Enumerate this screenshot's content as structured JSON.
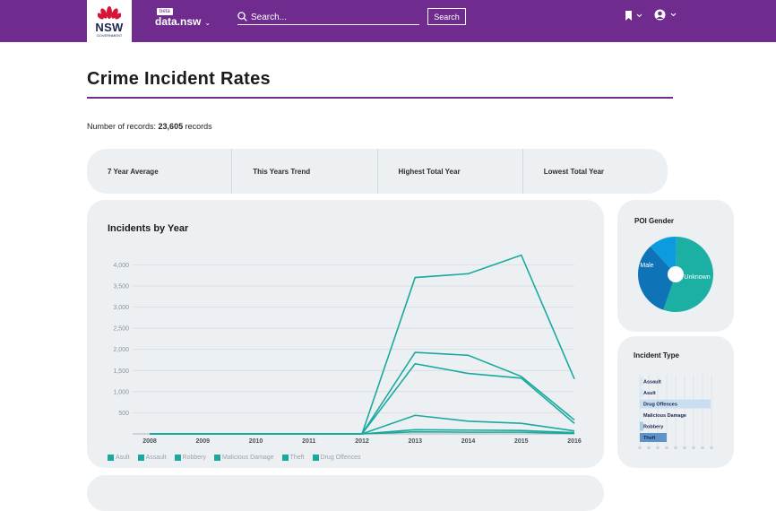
{
  "header": {
    "logo_text": "NSW",
    "logo_subtext": "GOVERNMENT",
    "beta_badge": "beta",
    "brand": "data.nsw",
    "search_placeholder": "Search...",
    "search_button": "Search",
    "bookmark_icon": "bookmark-icon",
    "account_icon": "user-icon"
  },
  "page": {
    "title": "Crime Incident Rates",
    "records_label": "Number of records:",
    "records_count": "23,605",
    "records_unit": "records"
  },
  "stats": [
    "7 Year Average",
    "This Years Trend",
    "Highest Total Year",
    "Lowest Total Year"
  ],
  "incidents_chart": {
    "title": "Incidents by Year",
    "chart_data": {
      "type": "line",
      "title": "Incidents by Year",
      "x": [
        "2008",
        "2009",
        "2010",
        "2011",
        "2012",
        "2013",
        "2014",
        "2015",
        "2016"
      ],
      "ylim": [
        0,
        4200
      ],
      "yticks": [
        "500",
        "1,000",
        "1,500",
        "2,000",
        "2,500",
        "3,000",
        "3,500",
        "4,000"
      ],
      "ytick_values": [
        500,
        1000,
        1500,
        2000,
        2500,
        3000,
        3500,
        4000
      ],
      "grid": true,
      "legend": "bottom",
      "series": [
        {
          "name": "Asult",
          "values": [
            0,
            0,
            0,
            0,
            0,
            3700,
            3790,
            4230,
            1300
          ]
        },
        {
          "name": "Assault",
          "values": [
            0,
            0,
            0,
            0,
            0,
            1930,
            1860,
            1360,
            330
          ]
        },
        {
          "name": "Robbery",
          "values": [
            0,
            0,
            0,
            0,
            0,
            1660,
            1430,
            1320,
            250
          ]
        },
        {
          "name": "Malicious Damage",
          "values": [
            0,
            0,
            0,
            0,
            0,
            440,
            300,
            250,
            70
          ]
        },
        {
          "name": "Theft",
          "values": [
            0,
            0,
            0,
            0,
            0,
            100,
            90,
            80,
            30
          ]
        },
        {
          "name": "Drug Offences",
          "values": [
            0,
            0,
            0,
            0,
            0,
            50,
            40,
            40,
            10
          ]
        }
      ]
    }
  },
  "gender_chart": {
    "title": "POI Gender",
    "chart_data": {
      "type": "pie",
      "slices": [
        {
          "label": "Unknown",
          "value": 55,
          "color": "#1cb0a4"
        },
        {
          "label": "Male",
          "value": 33,
          "color": "#0f73b7"
        },
        {
          "label": "",
          "value": 12,
          "color": "#0d9be0"
        }
      ]
    }
  },
  "incident_type_chart": {
    "title": "Incident Type",
    "chart_data": {
      "type": "bar",
      "orientation": "horizontal",
      "categories": [
        "Assault",
        "Asult",
        "Drug Offences",
        "Malicious Damage",
        "Robbery",
        "Theft"
      ],
      "values": [
        0.05,
        0.05,
        1.0,
        0.07,
        0.05,
        0.38
      ],
      "colors": [
        "#d7e9f5",
        "#d7e9f5",
        "#c9def0",
        "#e6eef5",
        "#a9cbe6",
        "#5c93c9"
      ]
    }
  },
  "colors": {
    "brand": "#6f2b8e",
    "line": "#1aa99e",
    "card": "#edf0f3"
  }
}
